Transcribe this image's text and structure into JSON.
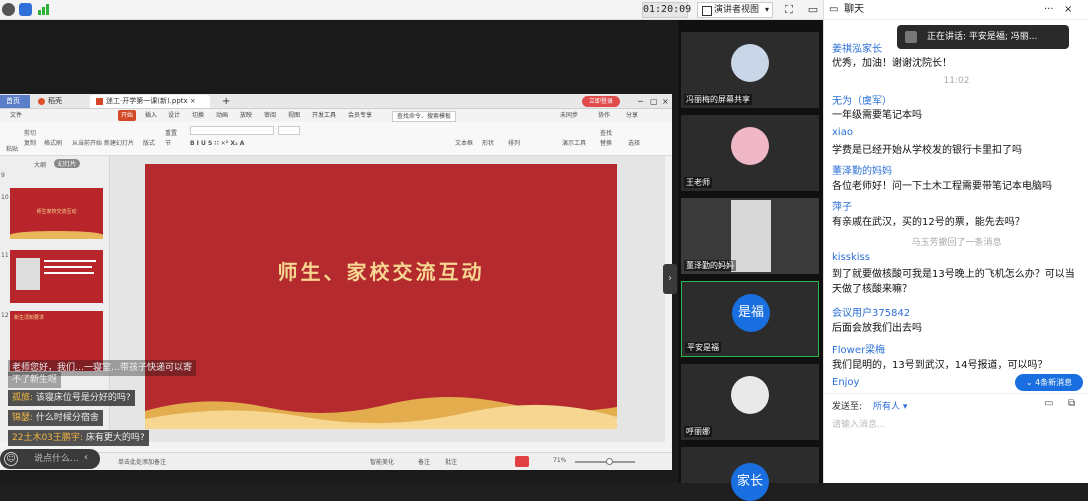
{
  "topbar": {
    "timer": "01:20:09",
    "view_label": "演讲者视图",
    "caret": "▾"
  },
  "chat": {
    "title": "聊天",
    "speaking": "正在讲话: 平安是福; 冯丽...",
    "messages": [
      {
        "name": "姜祺泓家长",
        "text": "优秀，加油！谢谢沈院长！"
      },
      {
        "time": "11:02"
      },
      {
        "name": "无为（虞军）",
        "text": "一年级需要笔记本吗"
      },
      {
        "name": "xiao",
        "text": "学费是已经开始从学校发的银行卡里扣了吗"
      },
      {
        "name": "董泽勤的妈妈",
        "text": "各位老师好！问一下土木工程需要带笔记本电脑吗"
      },
      {
        "name": "萍子",
        "text": "有亲戚在武汉，买的12号的票，能先去吗？"
      },
      {
        "system": "马玉芳撤回了一条消息"
      },
      {
        "name": "kisskiss",
        "text": "到了就要做核酸可我是13号晚上的飞机怎么办？可以当天做了核酸来嘛？"
      },
      {
        "name": "会议用户375842",
        "text": "后面会放我们出去吗"
      },
      {
        "name": "Flower梁梅",
        "text": "我们昆明的，13号到武汉，14号报道，可以吗？"
      },
      {
        "name": "Enjoy",
        "text": ""
      }
    ],
    "new_msgs": "4条新消息",
    "send_to_label": "发送至:",
    "send_to_value": "所有人",
    "input_placeholder": "请输入消息..."
  },
  "videos": [
    {
      "label": "冯丽梅的屏幕共享",
      "kind": "avatar"
    },
    {
      "label": "王老师",
      "kind": "avatar"
    },
    {
      "label": "董泽勤的妈妈",
      "kind": "camera"
    },
    {
      "label": "平安是福",
      "kind": "text",
      "initials": "是福"
    },
    {
      "label": "呼丽娜",
      "kind": "avatar"
    },
    {
      "label": "",
      "kind": "text",
      "initials": "家长"
    }
  ],
  "wps": {
    "tabs": [
      "首页",
      "稻壳",
      "迷工·开学第一课(新).pptx"
    ],
    "login": "立即登录",
    "menu": [
      "文件",
      "开始",
      "插入",
      "设计",
      "切换",
      "动画",
      "放映",
      "审阅",
      "视图",
      "开发工具",
      "会员专享"
    ],
    "search": "查找命令、搜索模板",
    "right_menu": [
      "未同步",
      "协作",
      "分享"
    ],
    "ribbon": [
      "粘贴",
      "剪切",
      "复制",
      "格式刷",
      "从当前开始",
      "新建幻灯片",
      "版式",
      "重置",
      "节",
      "文本框",
      "形状",
      "排列",
      "演示工具",
      "替换",
      "查找",
      "选择"
    ],
    "outline_tabs": [
      "大纲",
      "幻灯片"
    ],
    "slide_title": "师生、家校交流互动",
    "slide_numbers": [
      "9",
      "10",
      "11",
      "12"
    ],
    "thumb10": "师生家校交流互动",
    "thumb12": "新生须知要求",
    "status": {
      "notes_hint": "单击此处添加备注",
      "beautify": "智能美化",
      "notes": "备注",
      "comment": "批注",
      "zoom": "71%"
    }
  },
  "overlay": {
    "comments": [
      {
        "name": "",
        "text": "老师您好，我们…一寝室…带孩子快递可以寄"
      },
      {
        "name": "",
        "text": "不了新生呀"
      },
      {
        "name": "孤旅:",
        "text": "该寝床位号是分好的吗?"
      },
      {
        "name": "锦瑟:",
        "text": "什么时候分宿舍"
      },
      {
        "name": "22土木03王鹏宇:",
        "text": "床有更大的吗?"
      }
    ],
    "input_placeholder": "说点什么..."
  }
}
